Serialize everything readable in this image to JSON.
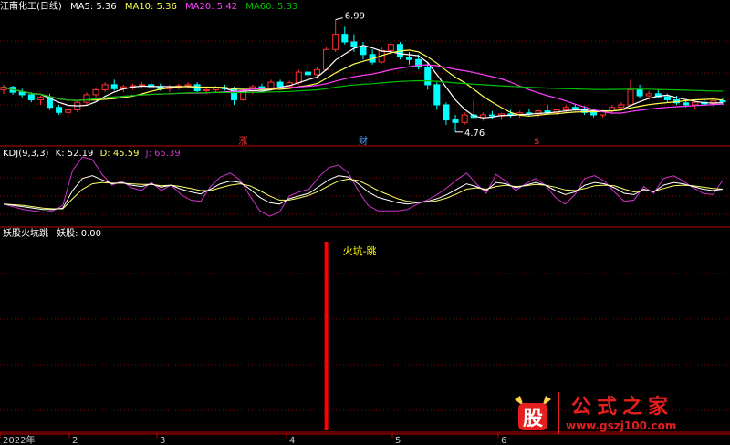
{
  "colors": {
    "ma5": "#ffffff",
    "ma10": "#ffff4f",
    "ma20": "#ff40ff",
    "ma60": "#00c000",
    "up": "#ff3232",
    "down": "#00ffff",
    "grid": "#8b0000",
    "axis": "#c00000",
    "kdj_k": "#ffffff",
    "kdj_d": "#ffff66",
    "kdj_j": "#cc33cc",
    "signal": "#ff0000",
    "annotation": "#ffff00"
  },
  "header": {
    "title": "江南化工(日线)",
    "ma5": "MA5: 5.36",
    "ma10": "MA10: 5.36",
    "ma20": "MA20: 5.42",
    "ma60": "MA60: 5.33"
  },
  "kdj_header": {
    "label": "KDJ(9,3,3)",
    "k": "K: 52.19",
    "d": "D: 45.59",
    "j": "J: 65.39"
  },
  "indicator_header": {
    "label": "妖股火坑跳",
    "value": "妖股: 0.00"
  },
  "watermark": {
    "logo_char": "股",
    "text": "公式之家",
    "url": "www.gszj100.com"
  },
  "chart_data": {
    "type": "candlestick",
    "price": {
      "high_label": "6.99",
      "low_label": "4.76",
      "event_markers": [
        "涨",
        "财",
        "$"
      ],
      "candles": [
        [
          5.6,
          5.7,
          5.52,
          5.65
        ],
        [
          5.65,
          5.68,
          5.5,
          5.55
        ],
        [
          5.55,
          5.62,
          5.45,
          5.5
        ],
        [
          5.5,
          5.55,
          5.35,
          5.4
        ],
        [
          5.4,
          5.48,
          5.3,
          5.45
        ],
        [
          5.45,
          5.52,
          5.2,
          5.25
        ],
        [
          5.25,
          5.3,
          5.1,
          5.15
        ],
        [
          5.15,
          5.25,
          5.05,
          5.2
        ],
        [
          5.2,
          5.38,
          5.15,
          5.35
        ],
        [
          5.35,
          5.55,
          5.3,
          5.5
        ],
        [
          5.5,
          5.65,
          5.45,
          5.6
        ],
        [
          5.6,
          5.75,
          5.55,
          5.7
        ],
        [
          5.7,
          5.8,
          5.58,
          5.62
        ],
        [
          5.62,
          5.7,
          5.55,
          5.66
        ],
        [
          5.66,
          5.72,
          5.6,
          5.68
        ],
        [
          5.68,
          5.75,
          5.62,
          5.7
        ],
        [
          5.7,
          5.78,
          5.62,
          5.66
        ],
        [
          5.66,
          5.72,
          5.58,
          5.62
        ],
        [
          5.62,
          5.7,
          5.55,
          5.65
        ],
        [
          5.65,
          5.72,
          5.6,
          5.68
        ],
        [
          5.68,
          5.75,
          5.62,
          5.7
        ],
        [
          5.7,
          5.75,
          5.55,
          5.58
        ],
        [
          5.58,
          5.65,
          5.52,
          5.6
        ],
        [
          5.6,
          5.68,
          5.55,
          5.64
        ],
        [
          5.64,
          5.7,
          5.58,
          5.62
        ],
        [
          5.62,
          5.66,
          5.3,
          5.4
        ],
        [
          5.4,
          5.62,
          5.38,
          5.58
        ],
        [
          5.58,
          5.7,
          5.52,
          5.66
        ],
        [
          5.66,
          5.72,
          5.55,
          5.6
        ],
        [
          5.6,
          5.8,
          5.58,
          5.75
        ],
        [
          5.75,
          5.8,
          5.62,
          5.66
        ],
        [
          5.66,
          5.78,
          5.62,
          5.74
        ],
        [
          5.74,
          6.0,
          5.7,
          5.95
        ],
        [
          5.95,
          6.1,
          5.85,
          5.9
        ],
        [
          5.9,
          6.05,
          5.82,
          6.0
        ],
        [
          6.0,
          6.45,
          5.98,
          6.4
        ],
        [
          6.4,
          6.99,
          6.35,
          6.7
        ],
        [
          6.7,
          6.85,
          6.5,
          6.55
        ],
        [
          6.55,
          6.7,
          6.35,
          6.45
        ],
        [
          6.45,
          6.55,
          6.2,
          6.3
        ],
        [
          6.3,
          6.4,
          6.1,
          6.15
        ],
        [
          6.15,
          6.45,
          6.12,
          6.38
        ],
        [
          6.38,
          6.55,
          6.3,
          6.5
        ],
        [
          6.5,
          6.55,
          6.2,
          6.25
        ],
        [
          6.25,
          6.35,
          6.1,
          6.2
        ],
        [
          6.2,
          6.3,
          6.0,
          6.05
        ],
        [
          6.05,
          6.15,
          5.6,
          5.7
        ],
        [
          5.7,
          5.75,
          5.2,
          5.3
        ],
        [
          5.3,
          5.35,
          4.9,
          5.0
        ],
        [
          5.0,
          5.1,
          4.76,
          4.95
        ],
        [
          4.95,
          5.15,
          4.9,
          5.1
        ],
        [
          5.1,
          5.4,
          5.05,
          5.05
        ],
        [
          5.05,
          5.15,
          4.98,
          5.1
        ],
        [
          5.1,
          5.18,
          5.02,
          5.08
        ],
        [
          5.08,
          5.14,
          5.0,
          5.12
        ],
        [
          5.12,
          5.2,
          5.05,
          5.1
        ],
        [
          5.1,
          5.18,
          5.04,
          5.14
        ],
        [
          5.14,
          5.22,
          5.08,
          5.12
        ],
        [
          5.12,
          5.2,
          5.06,
          5.18
        ],
        [
          5.18,
          5.3,
          5.12,
          5.15
        ],
        [
          5.15,
          5.22,
          5.1,
          5.2
        ],
        [
          5.2,
          5.3,
          5.15,
          5.25
        ],
        [
          5.25,
          5.32,
          5.18,
          5.22
        ],
        [
          5.22,
          5.28,
          5.1,
          5.15
        ],
        [
          5.15,
          5.22,
          5.05,
          5.1
        ],
        [
          5.1,
          5.2,
          5.05,
          5.18
        ],
        [
          5.18,
          5.3,
          5.12,
          5.25
        ],
        [
          5.25,
          5.35,
          5.2,
          5.3
        ],
        [
          5.3,
          5.8,
          5.28,
          5.6
        ],
        [
          5.6,
          5.7,
          5.42,
          5.48
        ],
        [
          5.48,
          5.58,
          5.4,
          5.52
        ],
        [
          5.52,
          5.6,
          5.44,
          5.46
        ],
        [
          5.46,
          5.52,
          5.35,
          5.4
        ],
        [
          5.4,
          5.48,
          5.3,
          5.34
        ],
        [
          5.34,
          5.4,
          5.25,
          5.3
        ],
        [
          5.3,
          5.38,
          5.22,
          5.35
        ],
        [
          5.35,
          5.42,
          5.28,
          5.32
        ],
        [
          5.32,
          5.4,
          5.26,
          5.38
        ],
        [
          5.38,
          5.45,
          5.3,
          5.36
        ]
      ]
    },
    "kdj": {
      "k": [
        30,
        28,
        26,
        24,
        22,
        22,
        24,
        50,
        68,
        72,
        66,
        60,
        62,
        58,
        56,
        60,
        55,
        58,
        52,
        48,
        45,
        52,
        60,
        64,
        62,
        52,
        40,
        32,
        30,
        38,
        42,
        46,
        56,
        66,
        72,
        70,
        60,
        48,
        40,
        36,
        32,
        30,
        32,
        34,
        38,
        44,
        52,
        60,
        56,
        50,
        62,
        60,
        54,
        58,
        62,
        58,
        50,
        44,
        48,
        58,
        62,
        60,
        54,
        46,
        44,
        52,
        48,
        58,
        62,
        60,
        56,
        52,
        50,
        52
      ],
      "d": [
        30,
        29,
        28,
        26,
        24,
        23,
        23,
        38,
        52,
        60,
        62,
        61,
        61,
        60,
        59,
        59,
        57,
        58,
        56,
        53,
        50,
        50,
        54,
        58,
        60,
        57,
        50,
        42,
        36,
        36,
        39,
        43,
        49,
        57,
        64,
        67,
        65,
        58,
        50,
        44,
        38,
        34,
        33,
        33,
        35,
        39,
        45,
        52,
        54,
        52,
        56,
        58,
        56,
        57,
        59,
        58,
        55,
        51,
        50,
        53,
        57,
        58,
        57,
        52,
        48,
        50,
        49,
        53,
        57,
        58,
        57,
        55,
        53,
        52
      ],
      "j": [
        30,
        26,
        22,
        20,
        18,
        20,
        28,
        80,
        100,
        96,
        74,
        58,
        64,
        54,
        50,
        62,
        50,
        58,
        44,
        36,
        34,
        56,
        70,
        76,
        66,
        42,
        20,
        12,
        18,
        42,
        48,
        52,
        70,
        84,
        88,
        76,
        50,
        28,
        20,
        20,
        20,
        22,
        30,
        36,
        44,
        54,
        66,
        76,
        60,
        46,
        74,
        64,
        50,
        60,
        68,
        58,
        40,
        30,
        44,
        68,
        72,
        64,
        48,
        34,
        36,
        56,
        46,
        68,
        72,
        64,
        54,
        46,
        44,
        65
      ]
    },
    "signal": {
      "name": "妖股",
      "annotation": "火坑-跳",
      "value": 0.0,
      "spike_index": 35,
      "spike_value": 1.0
    },
    "x_axis_labels": [
      "2022年",
      "2",
      "3",
      "4",
      "5",
      "6"
    ]
  }
}
